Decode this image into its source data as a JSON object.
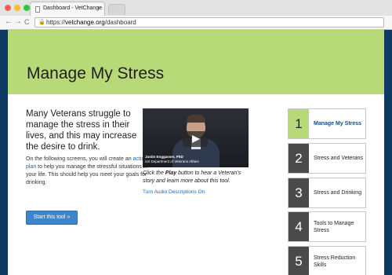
{
  "browser": {
    "tab_title": "Dashboard - VetChange",
    "tab_close": "×",
    "back": "←",
    "forward": "→",
    "reload": "C",
    "url_scheme": "https://",
    "url_host": "vetchange.org",
    "url_path": "/dashboard"
  },
  "hero": {
    "title": "Manage My Stress"
  },
  "intro": {
    "lead": "Many Veterans struggle to manage the stress in their lives, and this may increase the desire to drink.",
    "details_before": "On the following screens, you will create an ",
    "details_link": "action plan",
    "details_after": " to help you manage the stressful situations in your life. This should help you meet your goals for drinking.",
    "start_button": "Start this tool »"
  },
  "video": {
    "speaker_name": "Justin Enggasser, PhD",
    "speaker_affiliation": "US Department of Veterans Affairs",
    "caption_before": "Click the ",
    "caption_bold": "Play",
    "caption_after": " button to hear a Veteran's story and learn more about this tool.",
    "audio_link": "Turn Audio Descriptions On"
  },
  "steps": [
    {
      "number": "1",
      "label": "Manage My Stress",
      "active": true
    },
    {
      "number": "2",
      "label": "Stress and Veterans",
      "active": false
    },
    {
      "number": "3",
      "label": "Stress and Drinking",
      "active": false
    },
    {
      "number": "4",
      "label": "Tools to Manage Stress",
      "active": false
    },
    {
      "number": "5",
      "label": "Stress Reduction Skills",
      "active": false
    }
  ],
  "colors": {
    "hero_green": "#b8d978",
    "frame_navy": "#0d3a63",
    "link_blue": "#1a66b8",
    "button_blue": "#3e86c9",
    "step_dark": "#4a4a4a"
  }
}
